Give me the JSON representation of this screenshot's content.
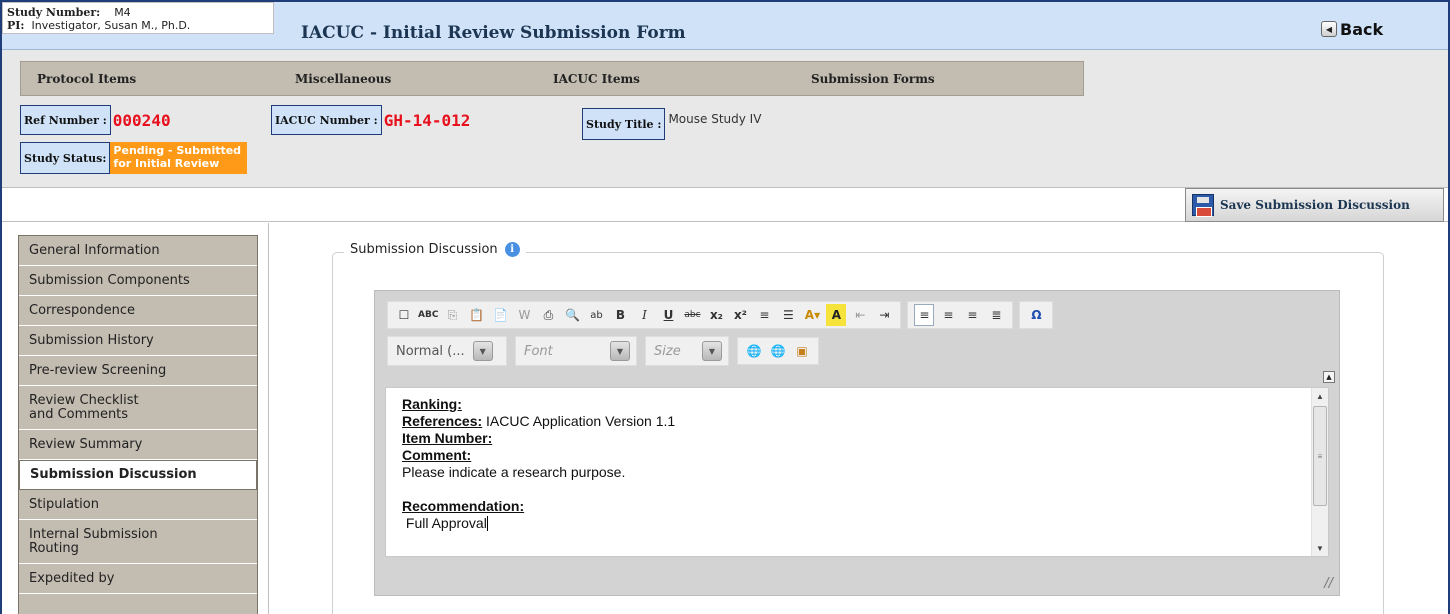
{
  "header": {
    "study_number_label": "Study Number:",
    "study_number_value": "M4",
    "pi_label": "PI:",
    "pi_value": "Investigator, Susan M., Ph.D.",
    "title": "IACUC - Initial Review Submission Form",
    "back_label": "Back"
  },
  "menu": {
    "items": [
      "Protocol Items",
      "Miscellaneous",
      "IACUC Items",
      "Submission Forms"
    ]
  },
  "fields": {
    "ref_number_label": "Ref Number :",
    "ref_number_value": "000240",
    "iacuc_number_label": "IACUC Number :",
    "iacuc_number_value": "GH-14-012",
    "study_title_label": "Study Title :",
    "study_title_value": "Mouse Study IV",
    "study_status_label": "Study Status:",
    "study_status_line1": "Pending - Submitted",
    "study_status_line2": "for Initial Review"
  },
  "toolbar": {
    "save_label": "Save Submission Discussion"
  },
  "sidebar": {
    "items": [
      {
        "label": "General Information"
      },
      {
        "label": "Submission Components"
      },
      {
        "label": "Correspondence"
      },
      {
        "label": "Submission History"
      },
      {
        "label": "Pre-review Screening"
      },
      {
        "label_line1": "Review Checklist",
        "label_line2": "and Comments"
      },
      {
        "label": "Review Summary"
      },
      {
        "label": "Submission Discussion",
        "active": true
      },
      {
        "label": "Stipulation"
      },
      {
        "label_line1": "Internal Submission",
        "label_line2": "Routing"
      },
      {
        "label": "Expedited by"
      }
    ]
  },
  "section": {
    "legend": "Submission Discussion"
  },
  "editor": {
    "combo_format": "Normal (...",
    "combo_font": "Font",
    "combo_size": "Size",
    "content": {
      "ranking_label": "Ranking:",
      "references_label": "References:",
      "references_value": "IACUC Application Version 1.1",
      "item_number_label": "Item Number:",
      "comment_label": "Comment:",
      "comment_value": "Please indicate a research purpose.",
      "recommendation_label": "Recommendation:",
      "recommendation_value": "Full Approval"
    }
  },
  "colors": {
    "header_bg": "#cfe2f8",
    "ref_red": "#e8101c",
    "status_orange": "#ff9a18",
    "nav_bg": "#c2bcb1"
  }
}
